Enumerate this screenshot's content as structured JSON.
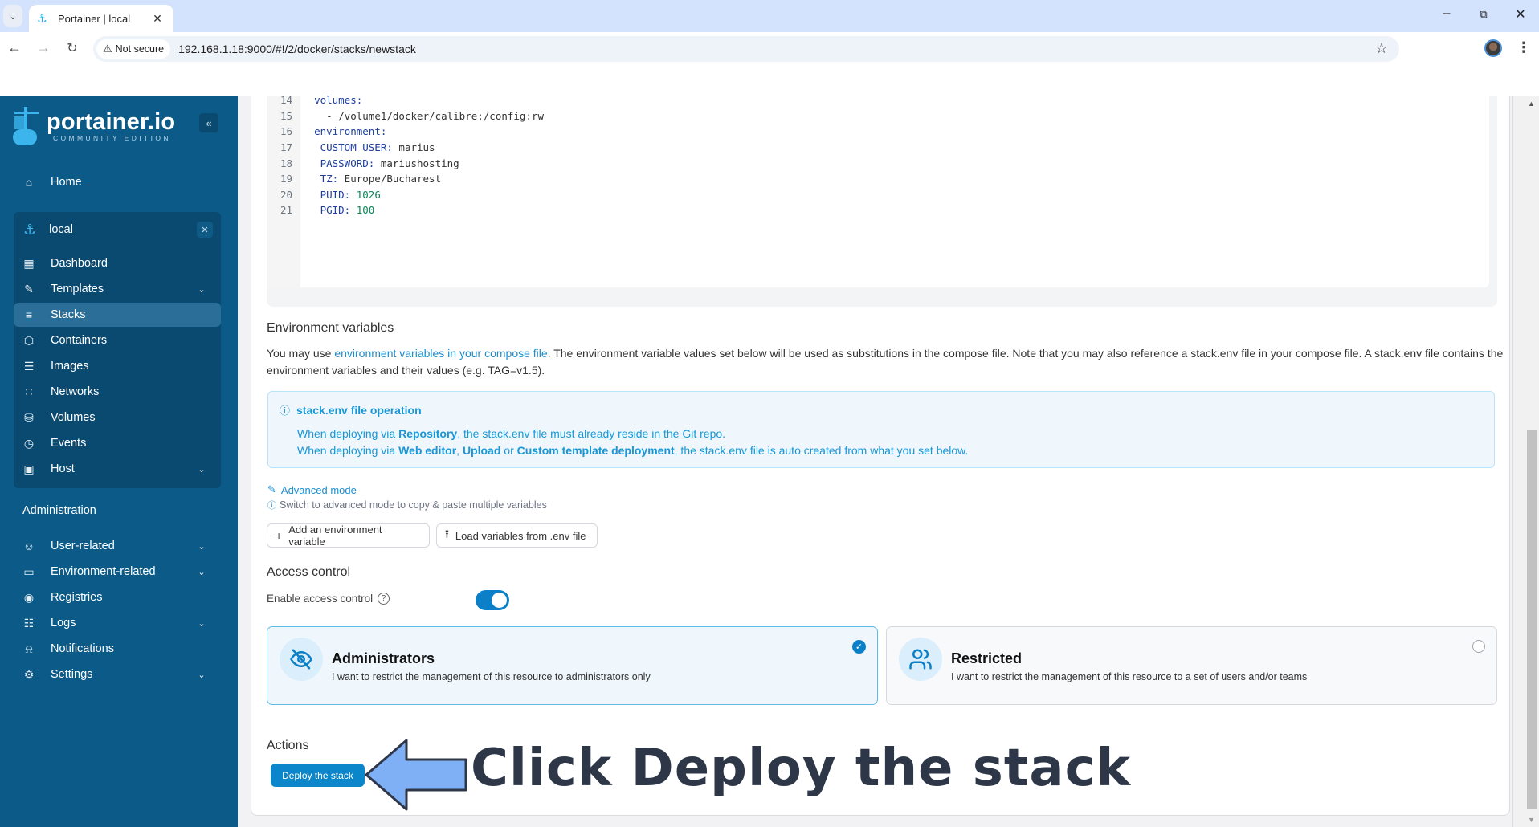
{
  "browser": {
    "tab_title": "Portainer | local",
    "security_label": "Not secure",
    "url": "192.168.1.18:9000/#!/2/docker/stacks/newstack"
  },
  "sidebar": {
    "logo_text": "portainer.io",
    "logo_subtext": "COMMUNITY EDITION",
    "home_label": "Home",
    "environment": {
      "name": "local"
    },
    "env_items": [
      {
        "label": "Dashboard",
        "icon": "dashboard-icon",
        "expandable": false,
        "active": false
      },
      {
        "label": "Templates",
        "icon": "edit-icon",
        "expandable": true,
        "active": false
      },
      {
        "label": "Stacks",
        "icon": "layers-icon",
        "expandable": false,
        "active": true
      },
      {
        "label": "Containers",
        "icon": "box-icon",
        "expandable": false,
        "active": false
      },
      {
        "label": "Images",
        "icon": "list-icon",
        "expandable": false,
        "active": false
      },
      {
        "label": "Networks",
        "icon": "network-icon",
        "expandable": false,
        "active": false
      },
      {
        "label": "Volumes",
        "icon": "database-icon",
        "expandable": false,
        "active": false
      },
      {
        "label": "Events",
        "icon": "clock-icon",
        "expandable": false,
        "active": false
      },
      {
        "label": "Host",
        "icon": "host-icon",
        "expandable": true,
        "active": false
      }
    ],
    "admin_title": "Administration",
    "admin_items": [
      {
        "label": "User-related",
        "icon": "users-icon",
        "expandable": true
      },
      {
        "label": "Environment-related",
        "icon": "drive-icon",
        "expandable": true
      },
      {
        "label": "Registries",
        "icon": "radio-icon",
        "expandable": false
      },
      {
        "label": "Logs",
        "icon": "file-icon",
        "expandable": true
      },
      {
        "label": "Notifications",
        "icon": "bell-icon",
        "expandable": false
      },
      {
        "label": "Settings",
        "icon": "gear-icon",
        "expandable": true
      }
    ]
  },
  "editor": {
    "lines": [
      {
        "n": "14",
        "indent": "",
        "key": "volumes:",
        "value": "",
        "value_type": ""
      },
      {
        "n": "15",
        "indent": "  ",
        "key": "",
        "value": "- /volume1/docker/calibre:/config:rw",
        "value_type": "str"
      },
      {
        "n": "16",
        "indent": "",
        "key": "environment:",
        "value": "",
        "value_type": ""
      },
      {
        "n": "17",
        "indent": " ",
        "key": "CUSTOM_USER:",
        "value": " marius",
        "value_type": "str"
      },
      {
        "n": "18",
        "indent": " ",
        "key": "PASSWORD:",
        "value": " mariushosting",
        "value_type": "str"
      },
      {
        "n": "19",
        "indent": " ",
        "key": "TZ:",
        "value": " Europe/Bucharest",
        "value_type": "str"
      },
      {
        "n": "20",
        "indent": " ",
        "key": "PUID:",
        "value": " 1026",
        "value_type": "num"
      },
      {
        "n": "21",
        "indent": " ",
        "key": "PGID:",
        "value": " 100",
        "value_type": "num"
      }
    ]
  },
  "env_vars": {
    "title": "Environment variables",
    "desc_prefix": "You may use ",
    "desc_link": "environment variables in your compose file",
    "desc_suffix": ". The environment variable values set below will be used as substitutions in the compose file. Note that you may also reference a stack.env file in your compose file. A stack.env file contains the environment variables and their values (e.g. TAG=v1.5).",
    "info_title": "stack.env file operation",
    "info_line1": {
      "p1": "When deploying via ",
      "b1": "Repository",
      "p2": ", the stack.env file must already reside in the Git repo."
    },
    "info_line2": {
      "p1": "When deploying via ",
      "b1": "Web editor",
      "p2": ", ",
      "b2": "Upload",
      "p3": " or ",
      "b3": "Custom template deployment",
      "p4": ", the stack.env file is auto created from what you set below."
    },
    "advanced_mode_label": "Advanced mode",
    "advanced_hint": "Switch to advanced mode to copy & paste multiple variables",
    "add_button": "Add an environment variable",
    "load_button": "Load variables from .env file"
  },
  "access_control": {
    "title": "Access control",
    "enable_label": "Enable access control",
    "enabled": true,
    "options": [
      {
        "title": "Administrators",
        "desc": "I want to restrict the management of this resource to administrators only",
        "selected": true
      },
      {
        "title": "Restricted",
        "desc": "I want to restrict the management of this resource to a set of users and/or teams",
        "selected": false
      }
    ]
  },
  "actions": {
    "title": "Actions",
    "deploy_button": "Deploy the stack"
  },
  "annotation": {
    "text": "Click Deploy the stack",
    "arrow_color": "#7fb0f5"
  },
  "colors": {
    "sidebar": "#0b5a87",
    "accent": "#0b86cb",
    "link": "#1a8fd1"
  }
}
